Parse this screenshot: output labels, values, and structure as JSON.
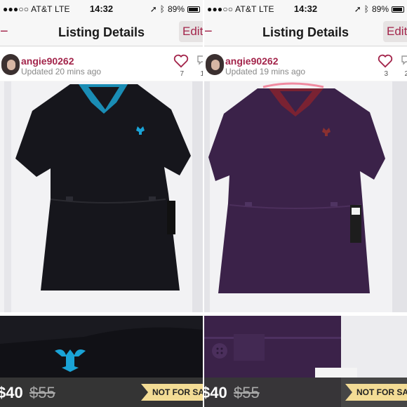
{
  "panels": [
    {
      "status": {
        "carrier": "●●●○○ AT&T  LTE",
        "time": "14:32",
        "battery": "89%"
      },
      "nav": {
        "back": "−",
        "title": "Listing Details",
        "edit": "Edit"
      },
      "seller": {
        "username": "angie90262",
        "updated": "Updated 20 mins ago",
        "likes": "7",
        "comments": "1"
      },
      "top_color": "#16161c",
      "tag_color": "#1aa3d6",
      "listing": {
        "price": "$40",
        "original_price": "$55",
        "badge": "NOT FOR SALE"
      }
    },
    {
      "status": {
        "carrier": "●●●○○ AT&T  LTE",
        "time": "14:32",
        "battery": "89%"
      },
      "nav": {
        "back": "−",
        "title": "Listing Details",
        "edit": "Edit"
      },
      "seller": {
        "username": "angie90262",
        "updated": "Updated 19 mins ago",
        "likes": "3",
        "comments": "2"
      },
      "top_color": "#3b2249",
      "tag_color": "#8a3030",
      "listing": {
        "price": "$40",
        "original_price": "$55",
        "badge": "NOT FOR SALE"
      }
    }
  ],
  "colors": {
    "brand": "#a3254b",
    "badge": "#f3dc95"
  }
}
